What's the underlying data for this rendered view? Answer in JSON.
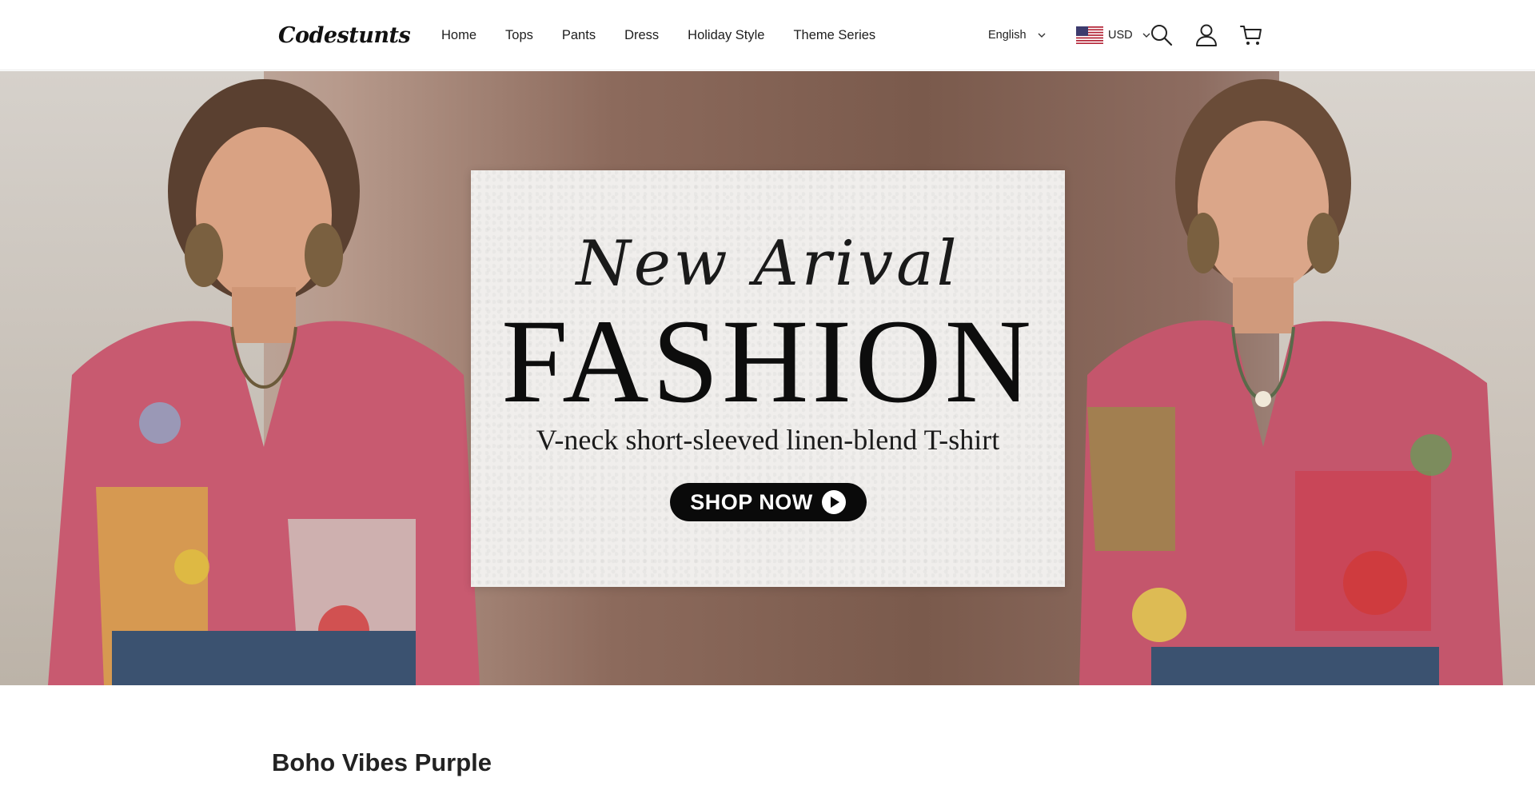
{
  "header": {
    "logo_text": "Codestunts",
    "nav": [
      {
        "label": "Home"
      },
      {
        "label": "Tops"
      },
      {
        "label": "Pants"
      },
      {
        "label": "Dress"
      },
      {
        "label": "Holiday Style"
      },
      {
        "label": "Theme Series"
      }
    ],
    "language": "English",
    "currency": "USD",
    "icons": [
      "search-icon",
      "account-icon",
      "cart-icon"
    ]
  },
  "hero": {
    "script_heading": "New Arival",
    "main_heading": "FASHION",
    "subheading": "V-neck short-sleeved linen-blend T-shirt",
    "cta_label": "SHOP NOW"
  },
  "section": {
    "title": "Boho Vibes Purple"
  },
  "colors": {
    "text": "#222222",
    "button_bg": "#0a0a0a",
    "card_bg": "#f0eeec"
  }
}
